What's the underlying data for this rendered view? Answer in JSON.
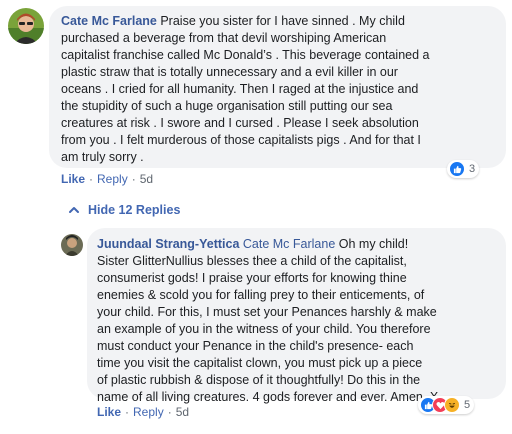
{
  "comment": {
    "author": "Cate Mc Farlane",
    "lines": [
      " Praise you sister for I have sinned . My child",
      "purchased a beverage from that devil worshiping American",
      "capitalist franchise called Mc Donald’s . This beverage contained a",
      "plastic straw that is totally unnecessary and a evil killer in our",
      "oceans . I cried for all humanity. Then I raged at the injustice and",
      "the stupidity of such a huge organisation still putting our sea",
      "creatures at risk . I swore and I cursed . Please I seek absolution",
      "from you . I felt murderous of those capitalists pigs . And for that I",
      "am truly sorry ."
    ],
    "like_label": "Like",
    "reply_label": "Reply",
    "time": "5d",
    "reaction_count": "3",
    "colors": {
      "like": "#1877f2"
    }
  },
  "replies_toggle": {
    "label": "Hide 12 Replies",
    "icon": "chevron-up-icon"
  },
  "reply": {
    "author": "Juundaal Strang-Yettica",
    "tagged": "Cate Mc Farlane",
    "lines": [
      " Oh my child!",
      "Sister GlitterNullius blesses thee a child of the capitalist,",
      "consumerist gods! I praise your efforts for knowing thine",
      "enemies & scold you for falling prey to their enticements, of",
      "your child. For this, I must set your Penances harshly & make",
      "an example of you in the witness of your child. You therefore",
      "must conduct your Penance in the child's presence- each",
      "time you visit the capitalist clown, you must pick up a piece",
      "of plastic rubbish & dispose of it thoughtfully! Do this in the",
      "name of all living creatures. 4 gods forever and ever. Amen. X"
    ],
    "like_label": "Like",
    "reply_label": "Reply",
    "time": "5d",
    "reaction_count": "5",
    "reactions": [
      "like-icon",
      "love-icon",
      "haha-icon"
    ],
    "colors": {
      "like": "#1877f2",
      "love": "#f33e58",
      "haha": "#f7b125"
    }
  }
}
